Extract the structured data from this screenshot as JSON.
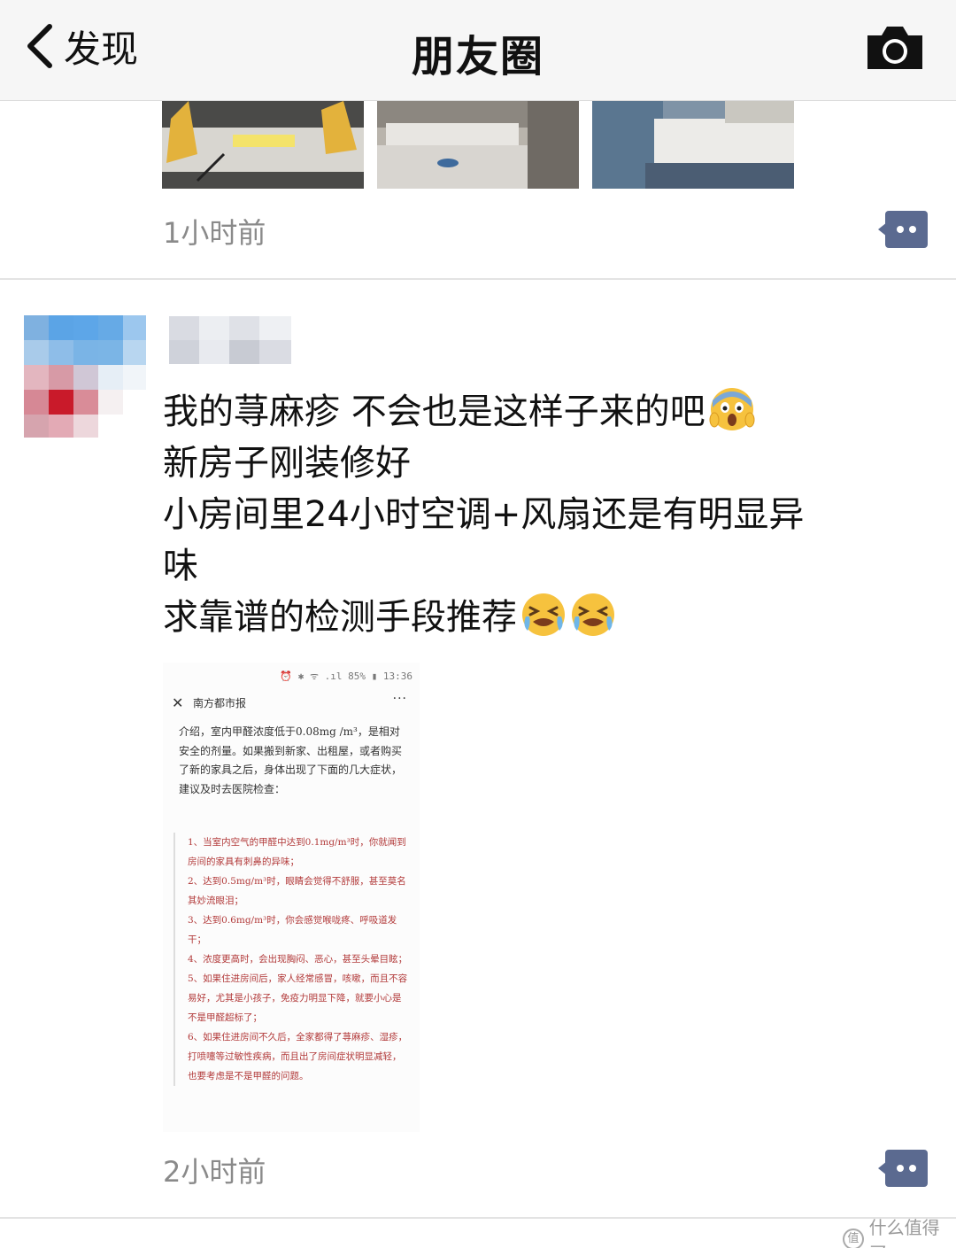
{
  "navbar": {
    "back_label": "发现",
    "title": "朋友圈",
    "camera_icon": "camera-icon"
  },
  "post1": {
    "time": "1小时前"
  },
  "post2": {
    "text_lines": [
      "我的荨麻疹 不会也是这样子来的吧",
      "新房子刚装修好",
      "小房间里24小时空调+风扇还是有明显异",
      "味",
      "求靠谱的检测手段推荐"
    ],
    "emojis": [
      "scream-emoji",
      "crying-emoji",
      "crying-emoji"
    ],
    "time": "2小时前",
    "attached_image": {
      "status_bar": "⏰ ✱ ᯤ .ıl 85% ▮ 13:36",
      "close_glyph": "✕",
      "source_name": "南方都市报",
      "more_glyph": "···",
      "intro": "介绍，室内甲醛浓度低于0.08mg /m³，是相对安全的剂量。如果搬到新家、出租屋，或者购买了新的家具之后，身体出现了下面的几大症状，建议及时去医院检查：",
      "list": [
        "1、当室内空气的甲醛中达到0.1mg/m³时，你就闻到房间的家具有刺鼻的异味；",
        "2、达到0.5mg/m³时，眼睛会觉得不舒服，甚至莫名其妙流眼泪；",
        "3、达到0.6mg/m³时，你会感觉喉咙疼、呼吸道发干；",
        "4、浓度更高时，会出现胸闷、恶心，甚至头晕目眩；",
        "5、如果住进房间后，家人经常感冒，咳嗽，而且不容易好，尤其是小孩子，免疫力明显下降，就要小心是不是甲醛超标了；",
        "6、如果住进房间不久后，全家都得了荨麻疹、湿疹，打喷嚏等过敏性疾病，而且出了房间症状明显减轻，也要考虑是不是甲醛的问题。"
      ]
    }
  },
  "watermark": {
    "logo": "值",
    "text": "什么值得买"
  },
  "colors": {
    "navbar_bg": "#f6f6f6",
    "time_text": "#8a8a8a",
    "comment_icon": "#5b6a90",
    "attach_list_text": "#b23a3a"
  }
}
